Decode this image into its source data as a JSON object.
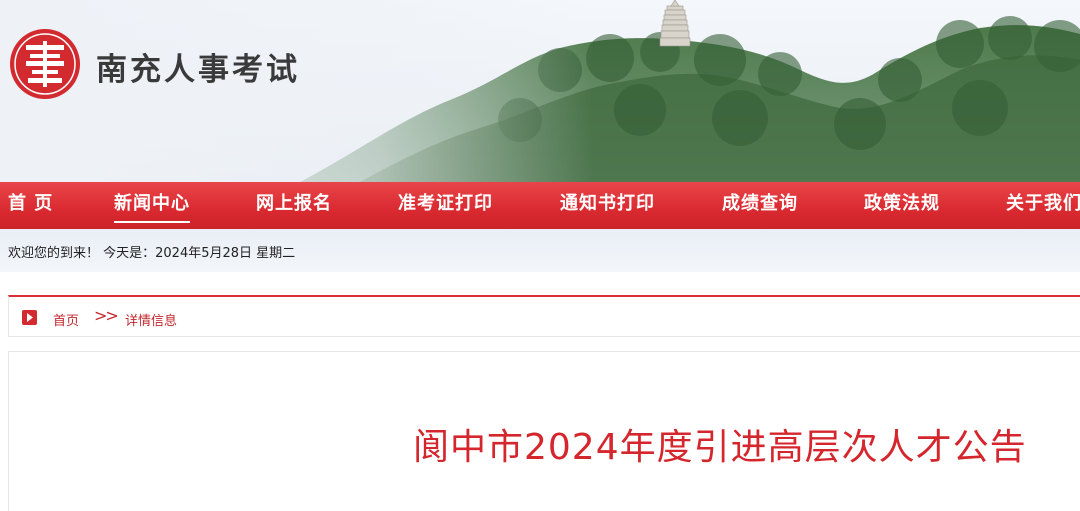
{
  "header": {
    "site_title": "南充人事考试",
    "logo_icon": "seal-logo-icon",
    "accent_color": "#d92a30"
  },
  "nav": {
    "items": [
      {
        "label": "首 页",
        "active": false
      },
      {
        "label": "新闻中心",
        "active": true
      },
      {
        "label": "网上报名",
        "active": false
      },
      {
        "label": "准考证打印",
        "active": false
      },
      {
        "label": "通知书打印",
        "active": false
      },
      {
        "label": "成绩查询",
        "active": false
      },
      {
        "label": "政策法规",
        "active": false
      },
      {
        "label": "关于我们",
        "active": false
      }
    ]
  },
  "welcome": {
    "text": "欢迎您的到来！ 今天是：2024年5月28日 星期二"
  },
  "breadcrumb": {
    "icon": "play-arrow-icon",
    "home": "首页",
    "separator": ">>",
    "current": "详情信息"
  },
  "article": {
    "title": "阆中市2024年度引进高层次人才公告",
    "title_color": "#d4262c"
  }
}
